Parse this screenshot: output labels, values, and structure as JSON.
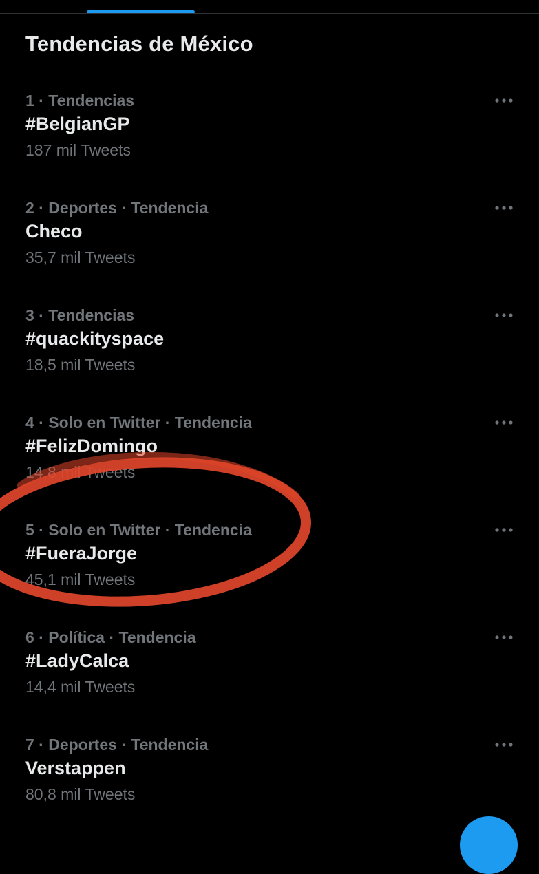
{
  "header": {
    "title": "Tendencias de México"
  },
  "trends": [
    {
      "meta": "1 · Tendencias",
      "name": "#BelgianGP",
      "count": "187 mil Tweets"
    },
    {
      "meta": "2 · Deportes · Tendencia",
      "name": "Checo",
      "count": "35,7 mil Tweets"
    },
    {
      "meta": "3 · Tendencias",
      "name": "#quackityspace",
      "count": "18,5 mil Tweets"
    },
    {
      "meta": "4 · Solo en Twitter · Tendencia",
      "name": "#FelizDomingo",
      "count": "14,8 mil Tweets"
    },
    {
      "meta": "5 · Solo en Twitter · Tendencia",
      "name": "#FueraJorge",
      "count": "45,1 mil Tweets"
    },
    {
      "meta": "6 · Política · Tendencia",
      "name": "#LadyCalca",
      "count": "14,4 mil Tweets"
    },
    {
      "meta": "7 · Deportes · Tendencia",
      "name": "Verstappen",
      "count": "80,8 mil Tweets"
    }
  ],
  "icons": {
    "more": "more-horizontal-icon"
  },
  "colors": {
    "background": "#000000",
    "primary_text": "#e7e9ea",
    "secondary_text": "#71767b",
    "accent": "#1d9bf0",
    "annotation": "#e0452a"
  }
}
